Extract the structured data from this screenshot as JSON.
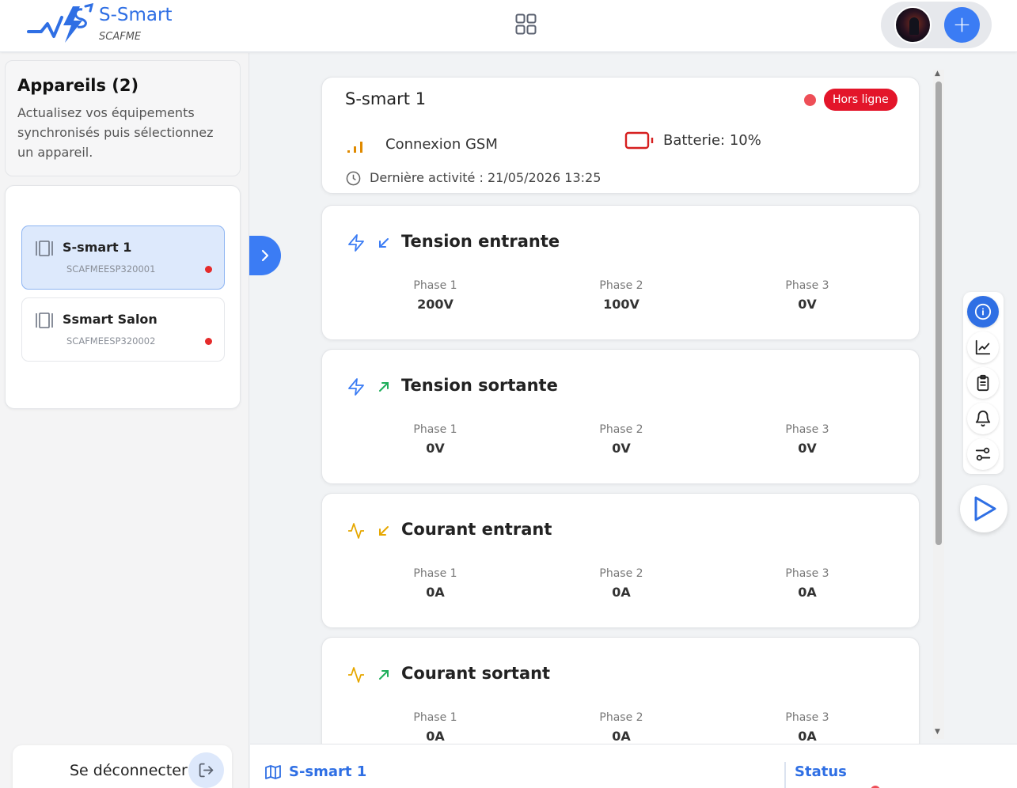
{
  "brand": {
    "name": "S-Smart",
    "subtitle": "SCAFME",
    "color": "#2f6fe4"
  },
  "sidebar": {
    "title": "Appareils (2)",
    "description": "Actualisez vos équipements synchronisés puis sélectionnez un appareil.",
    "devices": [
      {
        "name": "S-smart 1",
        "id": "SCAFMEESP320001",
        "status": "offline",
        "selected": true
      },
      {
        "name": "Ssmart Salon",
        "id": "SCAFMEESP320002",
        "status": "offline",
        "selected": false
      }
    ],
    "logout_label": "Se déconnecter"
  },
  "device": {
    "title": "S-smart 1",
    "status_badge": "Hors ligne",
    "connection": "Connexion GSM",
    "battery": "Batterie: 10%",
    "battery_level": 0.1,
    "last_activity": "Dernière activité : 21/05/2026 13:25"
  },
  "metrics": [
    {
      "title": "Tension entrante",
      "icon": "zap-icon",
      "direction": "incoming",
      "phases": [
        {
          "label": "Phase 1",
          "value": "200V"
        },
        {
          "label": "Phase 2",
          "value": "100V"
        },
        {
          "label": "Phase 3",
          "value": "0V"
        }
      ]
    },
    {
      "title": "Tension sortante",
      "icon": "zap-icon",
      "direction": "outgoing",
      "phases": [
        {
          "label": "Phase 1",
          "value": "0V"
        },
        {
          "label": "Phase 2",
          "value": "0V"
        },
        {
          "label": "Phase 3",
          "value": "0V"
        }
      ]
    },
    {
      "title": "Courant entrant",
      "icon": "activity-icon",
      "direction": "incoming",
      "phases": [
        {
          "label": "Phase 1",
          "value": "0A"
        },
        {
          "label": "Phase 2",
          "value": "0A"
        },
        {
          "label": "Phase 3",
          "value": "0A"
        }
      ]
    },
    {
      "title": "Courant sortant",
      "icon": "activity-icon",
      "direction": "outgoing",
      "phases": [
        {
          "label": "Phase 1",
          "value": "0A"
        },
        {
          "label": "Phase 2",
          "value": "0A"
        },
        {
          "label": "Phase 3",
          "value": "0A"
        }
      ]
    }
  ],
  "bottom_bar": {
    "device_name": "S-smart 1",
    "status_label": "Status"
  },
  "colors": {
    "accent": "#3b7cf4",
    "offline": "#e3152a",
    "voltage_icon": "#3b7cf4",
    "current_icon": "#e6a700",
    "incoming_arrow": "#3b7cf4",
    "outgoing_arrow": "#1fae5b",
    "selected_item": "#dde9fc"
  }
}
